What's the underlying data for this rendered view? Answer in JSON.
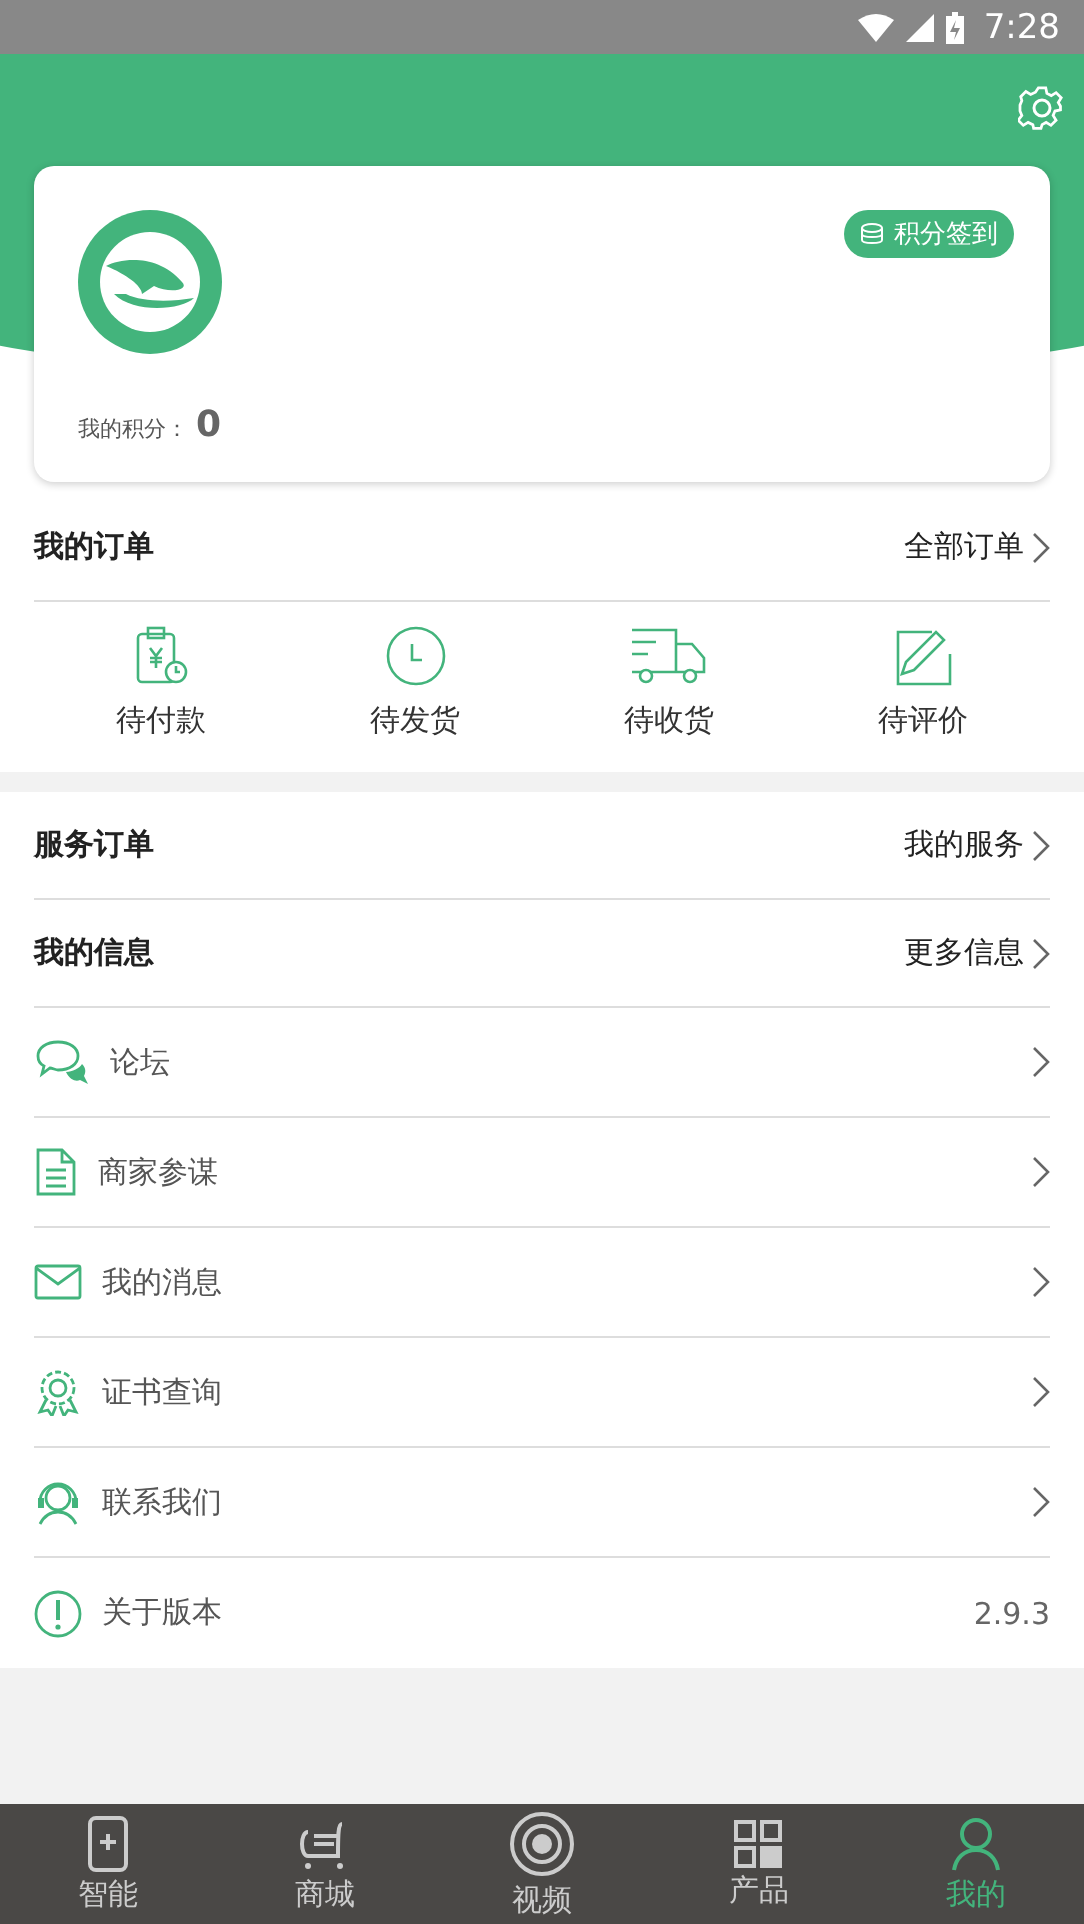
{
  "status_bar": {
    "time": "7:28"
  },
  "profile": {
    "points_label": "我的积分：",
    "points": "0",
    "checkin_button": "积分签到"
  },
  "orders": {
    "title": "我的订单",
    "link": "全部订单",
    "items": [
      {
        "label": "待付款",
        "kind": "payment"
      },
      {
        "label": "待发货",
        "kind": "clock"
      },
      {
        "label": "待收货",
        "kind": "truck"
      },
      {
        "label": "待评价",
        "kind": "edit"
      }
    ]
  },
  "sections": [
    {
      "title": "服务订单",
      "link": "我的服务"
    },
    {
      "title": "我的信息",
      "link": "更多信息"
    }
  ],
  "menu": [
    {
      "label": "论坛",
      "kind": "forum"
    },
    {
      "label": "商家参谋",
      "kind": "document"
    },
    {
      "label": "我的消息",
      "kind": "mail"
    },
    {
      "label": "证书查询",
      "kind": "certificate"
    },
    {
      "label": "联系我们",
      "kind": "support"
    },
    {
      "label": "关于版本",
      "kind": "about",
      "value": "2.9.3"
    }
  ],
  "tab_bar": [
    {
      "label": "智能",
      "kind": "tablet",
      "selected": false
    },
    {
      "label": "商城",
      "kind": "cart",
      "selected": false
    },
    {
      "label": "视频",
      "kind": "video",
      "selected": false
    },
    {
      "label": "产品",
      "kind": "grid",
      "selected": false
    },
    {
      "label": "我的",
      "kind": "user",
      "selected": true
    }
  ]
}
